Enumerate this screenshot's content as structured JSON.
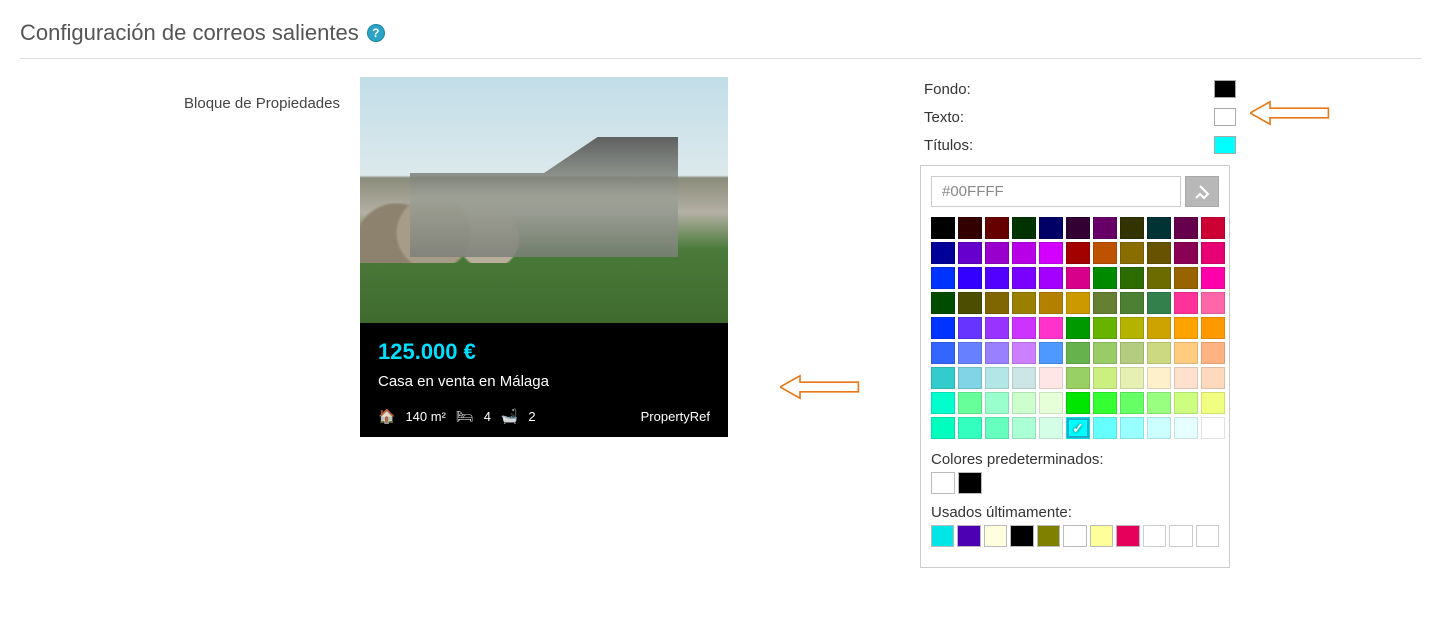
{
  "header": {
    "title": "Configuración de correos salientes"
  },
  "left": {
    "block_label": "Bloque de Propiedades"
  },
  "card": {
    "price": "125.000 €",
    "title": "Casa en venta en Málaga",
    "area": "140 m²",
    "beds": "4",
    "baths": "2",
    "ref": "PropertyRef"
  },
  "colorLabels": {
    "fondo": "Fondo:",
    "texto": "Texto:",
    "titulos": "Títulos:",
    "fondo_color": "#000000",
    "texto_color": "#FFFFFF",
    "titulos_color": "#00FFFF"
  },
  "picker": {
    "input_value": "#00FFFF",
    "predeterminados_label": "Colores predeterminados:",
    "recientes_label": "Usados últimamente:",
    "palette": [
      [
        "#000000",
        "#330000",
        "#660000",
        "#003300",
        "#000066",
        "#330033",
        "#660066",
        "#333300",
        "#003333",
        "#66004d",
        "#cc0033"
      ],
      [
        "#000099",
        "#6600cc",
        "#9900cc",
        "#b800e6",
        "#d400ff",
        "#a30000",
        "#bd5200",
        "#8a6d00",
        "#665200",
        "#8a0052",
        "#e60073"
      ],
      [
        "#0033ff",
        "#3300ff",
        "#5200ff",
        "#7a00ff",
        "#a300ff",
        "#d6008a",
        "#008a00",
        "#2b6b00",
        "#6b6b00",
        "#996300",
        "#ff00aa"
      ],
      [
        "#004d00",
        "#4d4d00",
        "#806600",
        "#998000",
        "#b38000",
        "#cc9900",
        "#668033",
        "#4d8033",
        "#33804d",
        "#ff3399",
        "#ff66aa"
      ],
      [
        "#0033ff",
        "#6633ff",
        "#9933ff",
        "#cc33ff",
        "#ff33cc",
        "#009900",
        "#66b300",
        "#b3b300",
        "#cca300",
        "#ffa300",
        "#ff9900"
      ],
      [
        "#3366ff",
        "#6680ff",
        "#9980ff",
        "#cc80ff",
        "#4d99ff",
        "#66b34d",
        "#99cc66",
        "#b3cc80",
        "#ccd980",
        "#ffcc80",
        "#ffb380"
      ],
      [
        "#33cccc",
        "#80d4e6",
        "#b3e6e6",
        "#cce6e6",
        "#ffe6e6",
        "#99d066",
        "#ccf080",
        "#e6f0b3",
        "#fff0cc",
        "#ffe0cc",
        "#ffd9bd"
      ],
      [
        "#00ffcc",
        "#66ff99",
        "#99ffcc",
        "#ccffcc",
        "#e6ffd9",
        "#00e600",
        "#33ff33",
        "#66ff66",
        "#99ff80",
        "#ccff80",
        "#f0ff80"
      ],
      [
        "#00ffbf",
        "#33ffbf",
        "#66ffbf",
        "#aaffd4",
        "#d4ffe6",
        "#00ffff",
        "#66ffff",
        "#99ffff",
        "#ccffff",
        "#e6ffff",
        "#ffffff"
      ]
    ],
    "selected_row": 8,
    "selected_col": 5,
    "default_colors": [
      "#FFFFFF",
      "#000000"
    ],
    "recent_colors": [
      "#00e6e6",
      "#4d00b3",
      "#ffffe0",
      "#000000",
      "#808000",
      "#ffffff",
      "#ffff99",
      "#e6005c",
      "",
      "",
      ""
    ]
  }
}
